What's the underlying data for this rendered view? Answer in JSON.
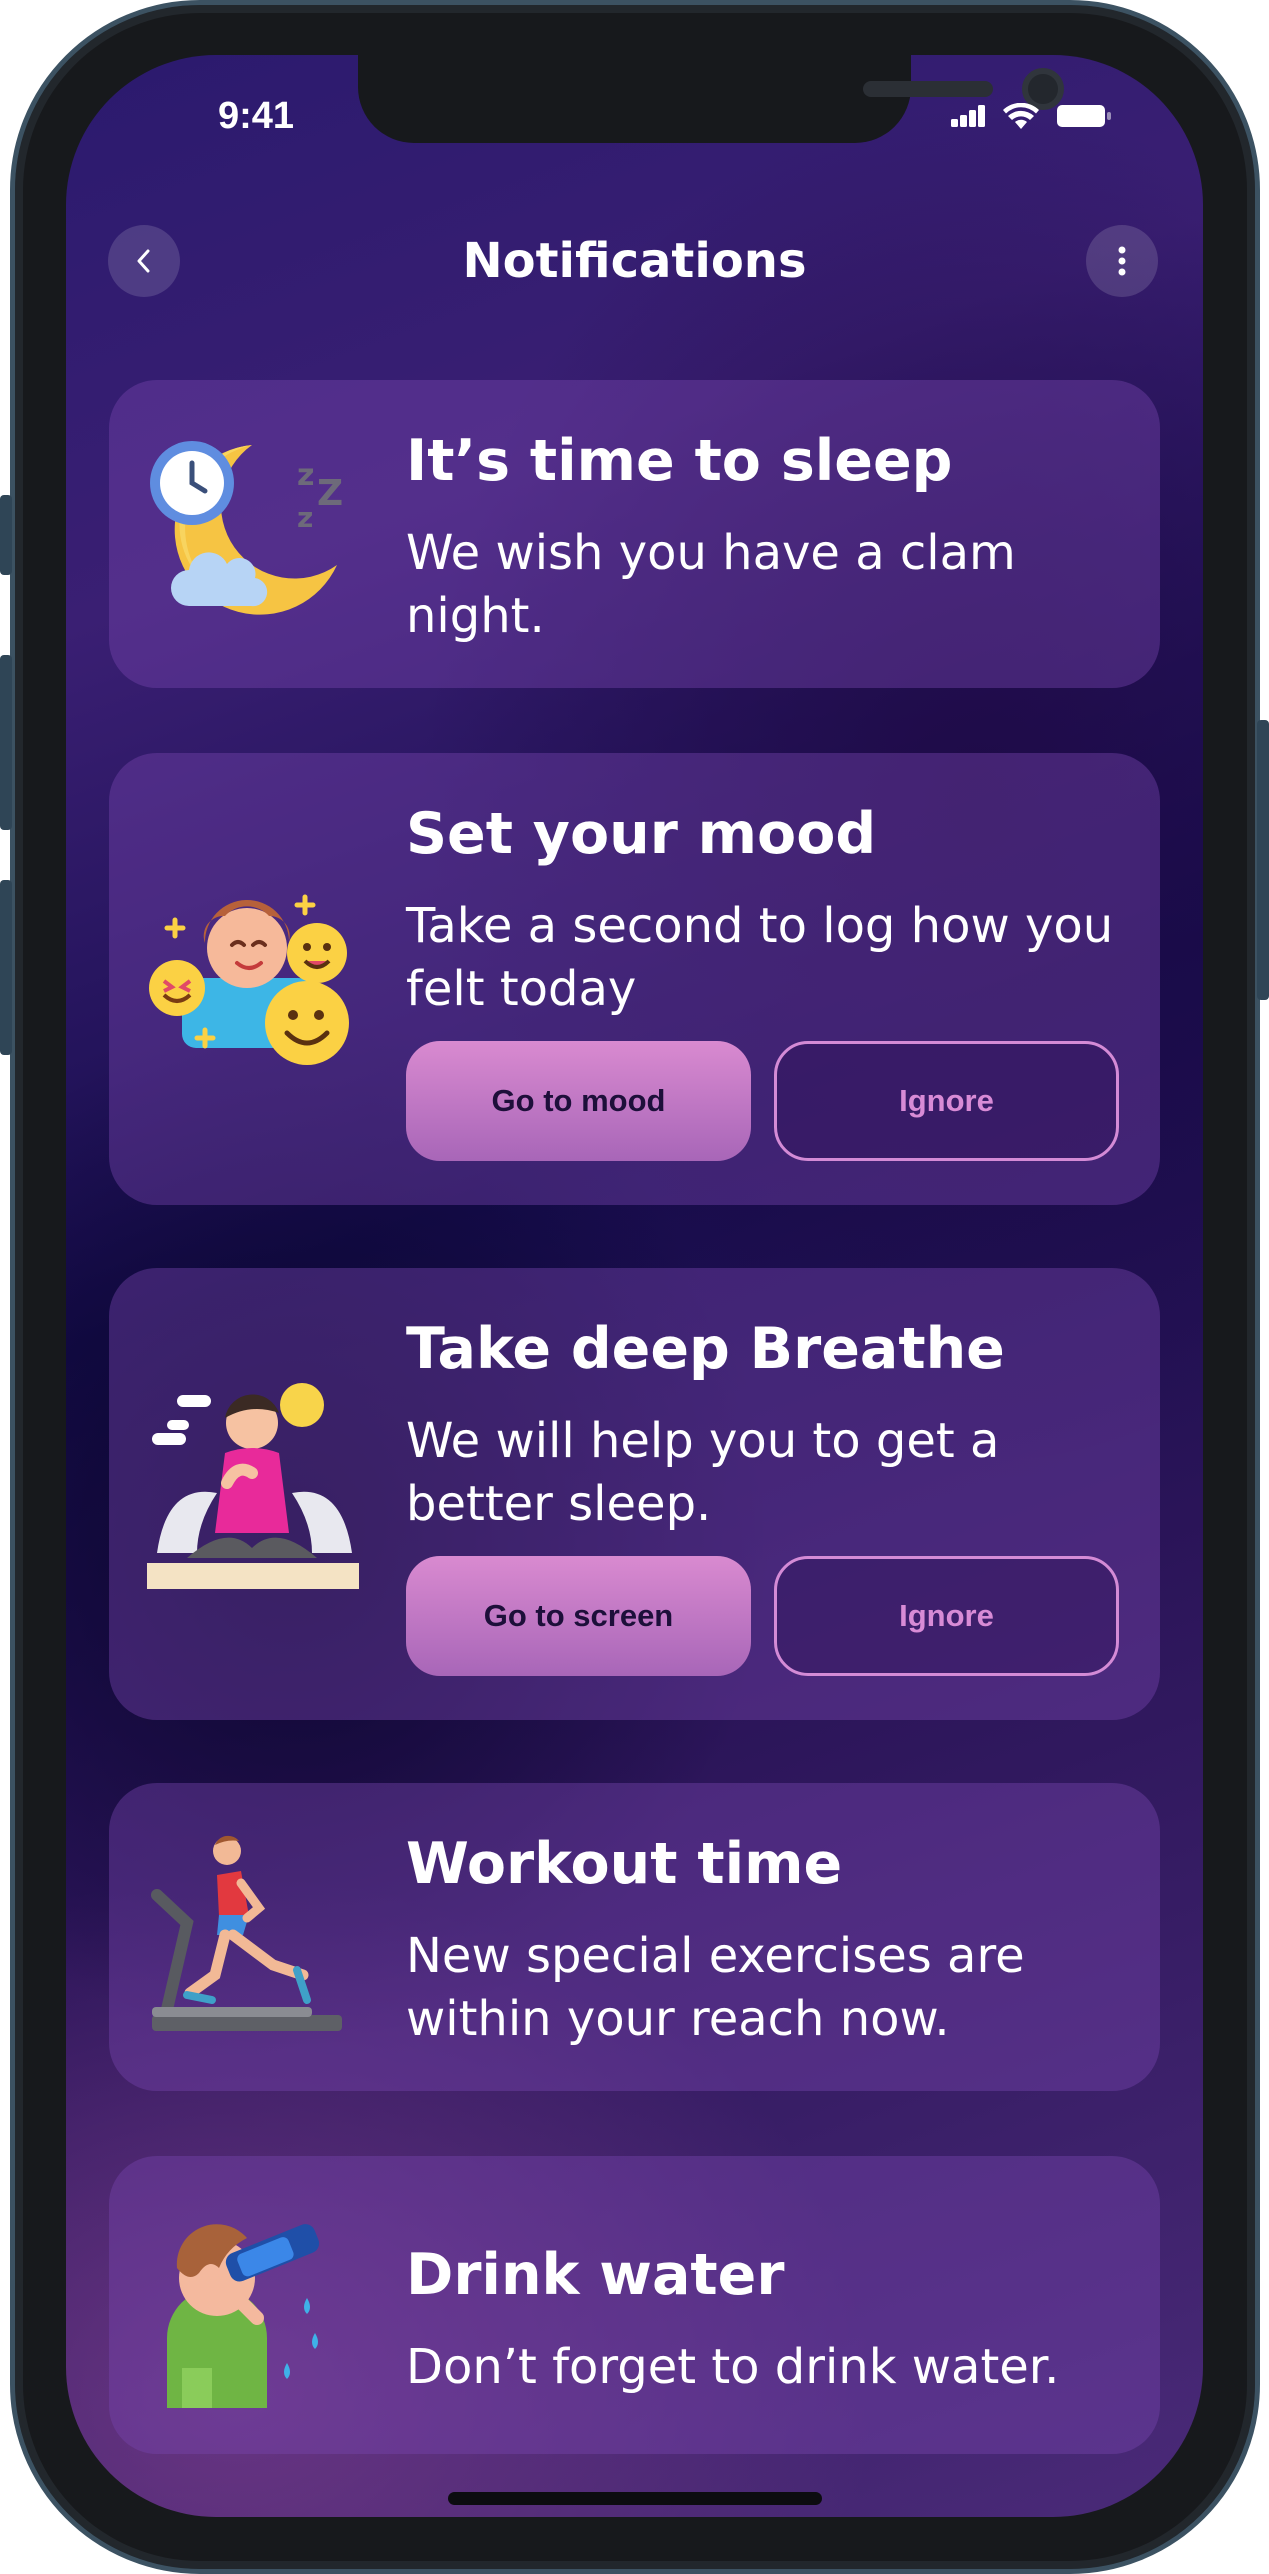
{
  "status_bar": {
    "time": "9:41",
    "icons": [
      "cellular-signal-icon",
      "wifi-icon",
      "battery-icon"
    ]
  },
  "header": {
    "title": "Notifications",
    "back_icon": "chevron-left-icon",
    "menu_icon": "more-vertical-icon"
  },
  "notifications": [
    {
      "illustration": "moon-clock-sleep-icon",
      "title": "It’s time to sleep",
      "text": "We wish you have a clam night."
    },
    {
      "illustration": "mood-emoji-person-icon",
      "title": "Set your mood",
      "text": "Take a second to log how you felt today",
      "primary_label": "Go to mood",
      "secondary_label": "Ignore"
    },
    {
      "illustration": "meditation-person-icon",
      "title": "Take deep Breathe",
      "text": "We will help you to get a better sleep.",
      "primary_label": "Go to screen",
      "secondary_label": "Ignore"
    },
    {
      "illustration": "treadmill-runner-icon",
      "title": "Workout time",
      "text": "New special exercises are within your reach now."
    },
    {
      "illustration": "drinking-water-person-icon",
      "title": "Drink water",
      "text": "Don’t forget to drink water."
    }
  ],
  "colors": {
    "background_top": "#2b1a6e",
    "background_mid": "#150c4c",
    "background_bottom": "#4a2a78",
    "card": "#6a3fa0",
    "accent_pink": "#d88bd6",
    "text": "#ffffff"
  }
}
